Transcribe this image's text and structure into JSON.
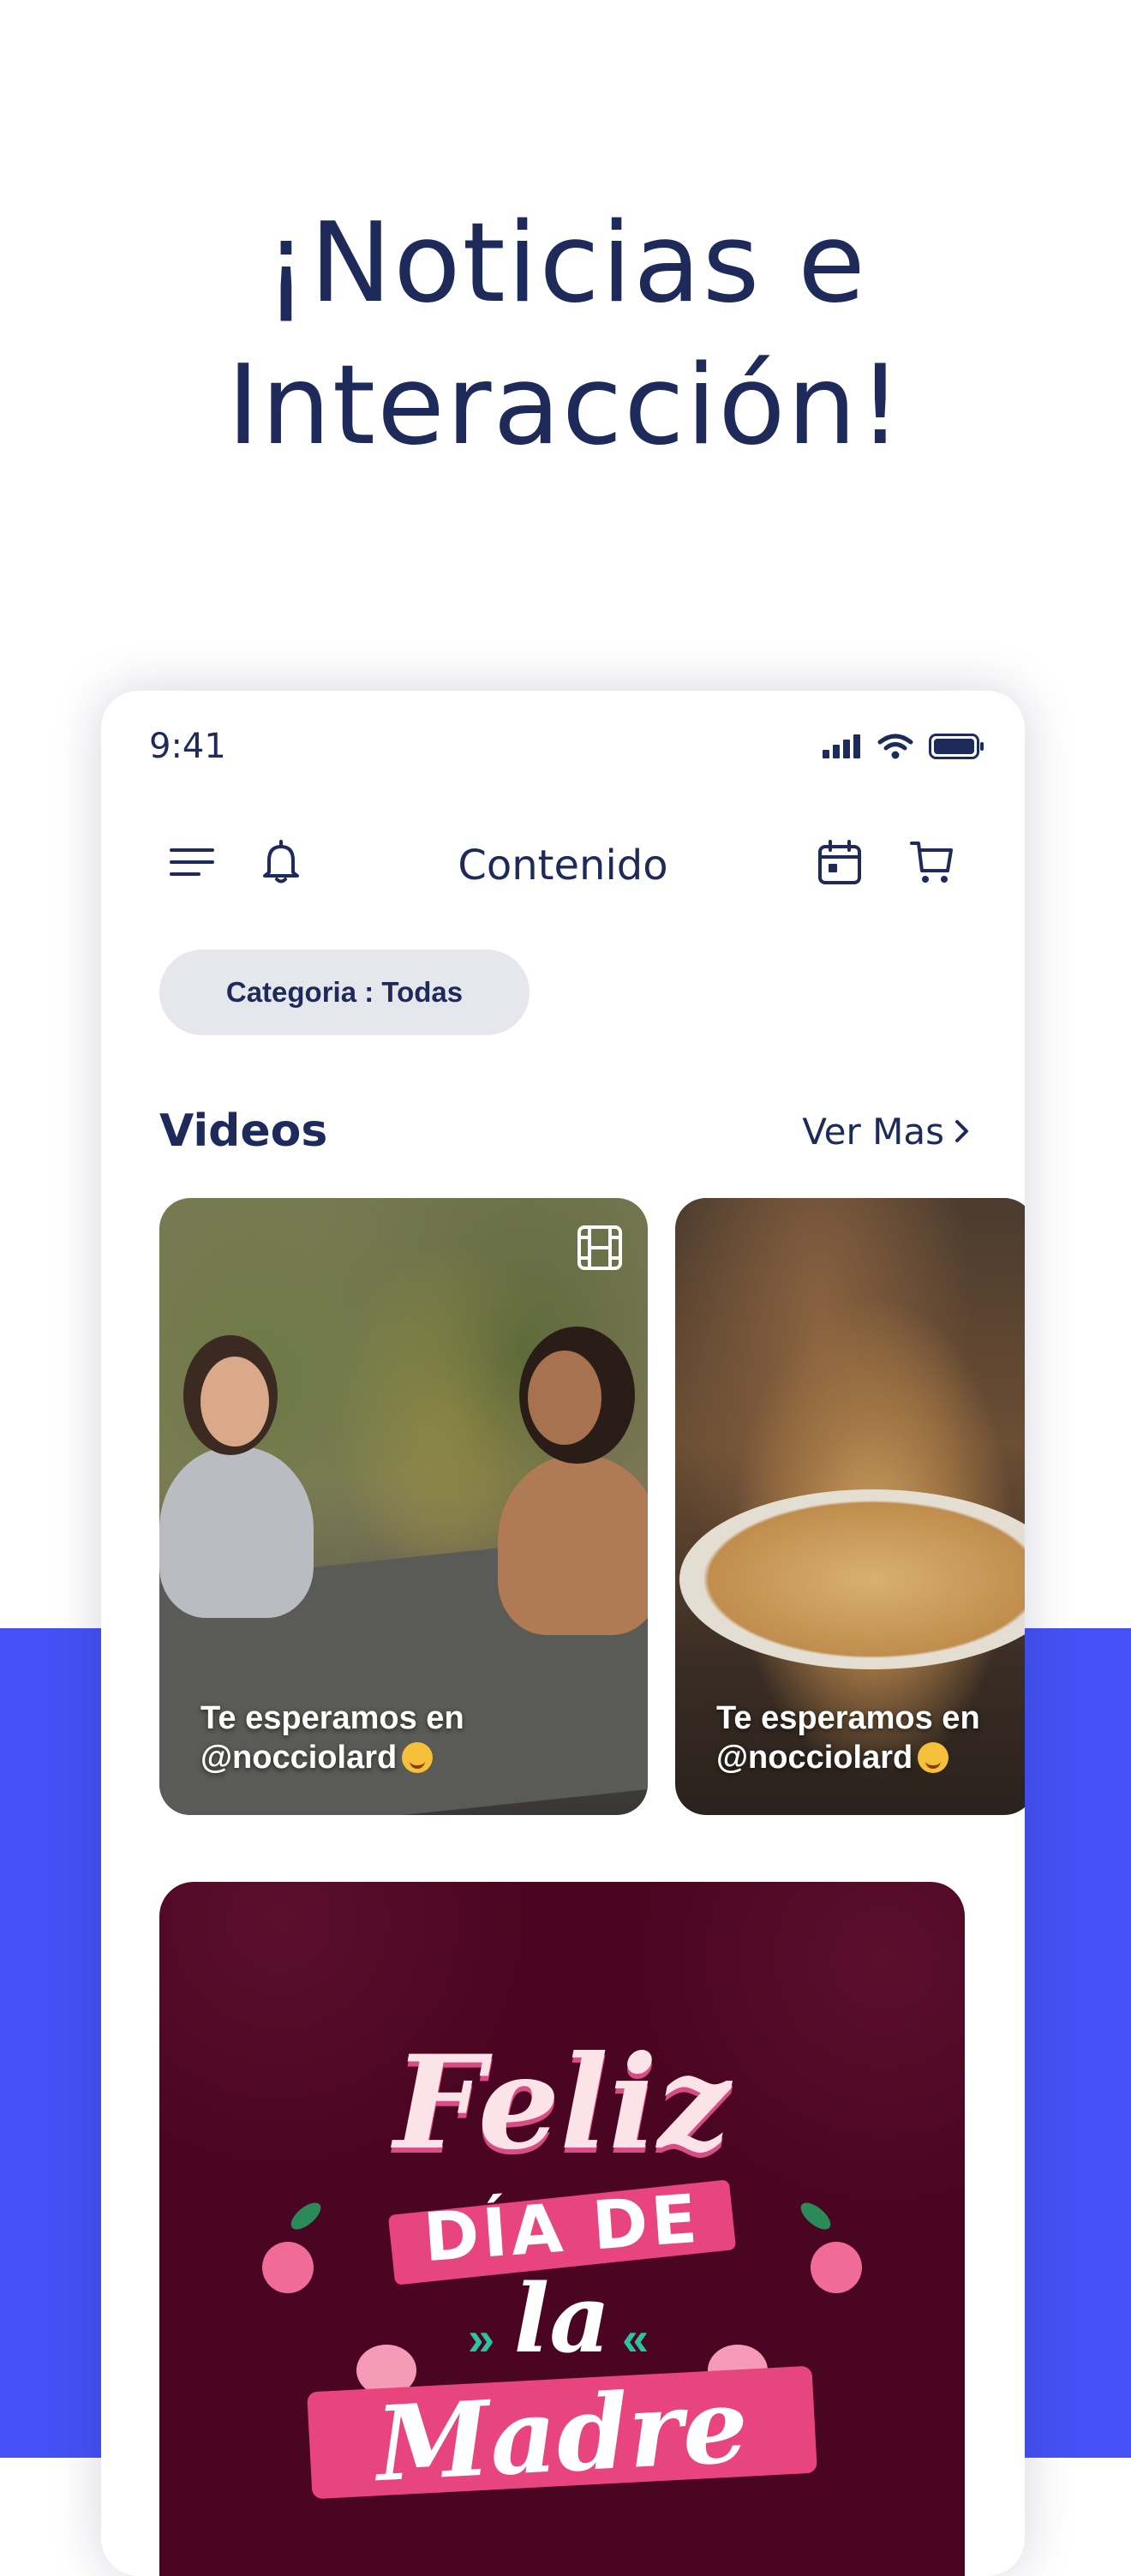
{
  "headline": {
    "line1": "¡Noticias e",
    "line2": "Interacción!"
  },
  "status_bar": {
    "time": "9:41"
  },
  "app_bar": {
    "title": "Contenido"
  },
  "filter": {
    "label": "Categoria : Todas"
  },
  "videos_section": {
    "title": "Videos",
    "see_more": "Ver Mas",
    "cards": [
      {
        "caption_line1": "Te esperamos en",
        "caption_line2": "@nocciolard"
      },
      {
        "caption_line1": "Te esperamos en",
        "caption_line2": "@nocciolard"
      }
    ]
  },
  "promo_banner": {
    "line1": "Feliz",
    "line2": "DÍA DE",
    "line3": "la",
    "line4": "Madre"
  },
  "colors": {
    "navy": "#1e2a5a",
    "accent_blue": "#4452f5",
    "chip_bg": "#e6e7ec",
    "promo_bg": "#4a0522",
    "promo_pink": "#e8457e"
  },
  "icons": [
    "menu-icon",
    "bell-icon",
    "calendar-icon",
    "cart-icon",
    "signal-icon",
    "wifi-icon",
    "battery-icon",
    "film-icon",
    "chevron-right-icon"
  ]
}
